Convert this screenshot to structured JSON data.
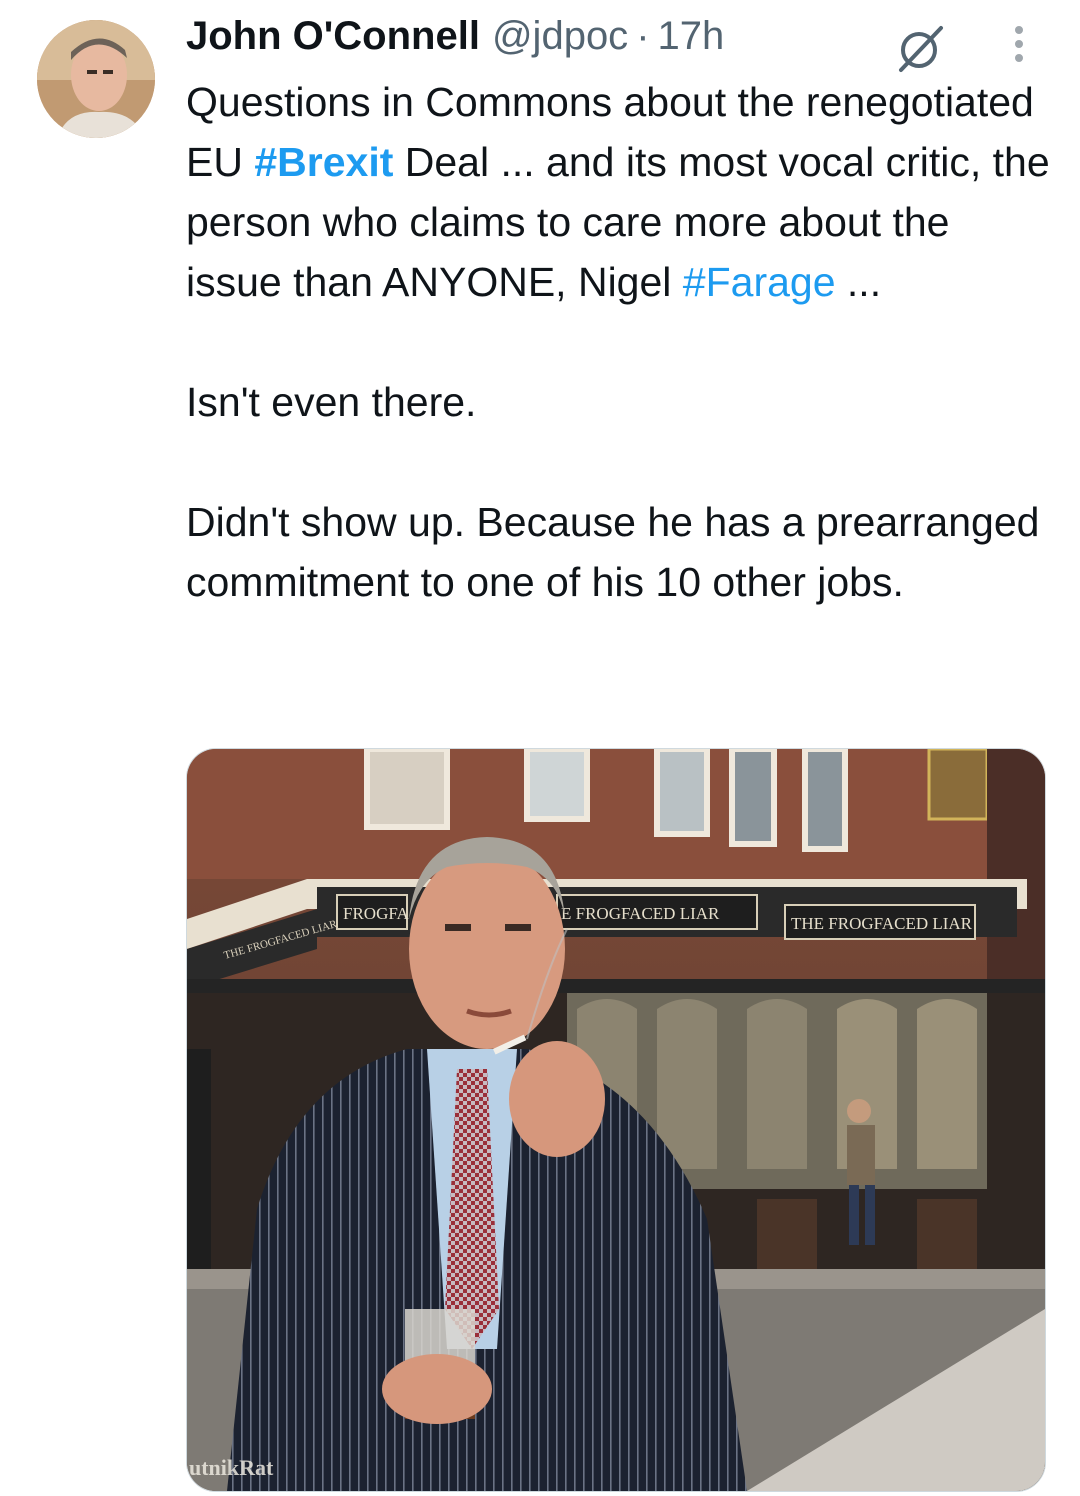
{
  "author": {
    "name": "John O'Connell",
    "handle": "@jdpoc",
    "separator": "·",
    "time": "17h"
  },
  "icons": {
    "avatar": "user-avatar-photo",
    "grok": "grok-slash-circle-icon",
    "more": "more-vertical-icon"
  },
  "tweet": {
    "p1_a": "Questions in Commons about the renegotiated EU ",
    "p1_tag1": "#Brexit",
    "p1_b": " Deal ... and its most vocal critic, the person who claims to care more about the issue than ANYONE, Nigel ",
    "p1_tag2": "#Farage",
    "p1_c": " ...",
    "p2": "Isn't even there.",
    "p3": "Didn't show up. Because he has a prearranged commitment to one of his 10 other jobs."
  },
  "media": {
    "sign_1": "FROGFA",
    "sign_2": "E FROGFACED LIAR",
    "sign_3": "THE FROGFACED LIAR",
    "sign_side": "THE FROGFACED LIAR",
    "watermark": "utnikRat"
  },
  "colors": {
    "link": "#1d9bf0",
    "text": "#0f1419",
    "secondary": "#536471"
  }
}
